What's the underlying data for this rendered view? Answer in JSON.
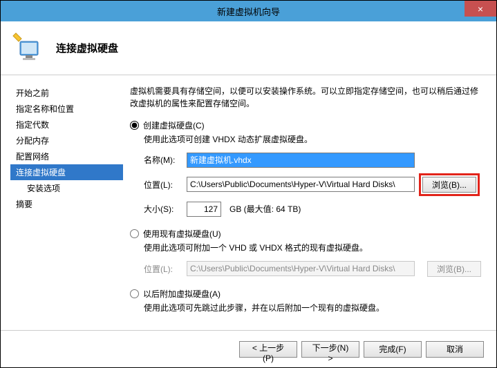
{
  "window": {
    "title": "新建虚拟机向导",
    "close": "×"
  },
  "header": {
    "title": "连接虚拟硬盘"
  },
  "sidebar": {
    "items": [
      {
        "label": "开始之前"
      },
      {
        "label": "指定名称和位置"
      },
      {
        "label": "指定代数"
      },
      {
        "label": "分配内存"
      },
      {
        "label": "配置网络"
      },
      {
        "label": "连接虚拟硬盘",
        "selected": true
      },
      {
        "label": "安装选项",
        "sub": true
      },
      {
        "label": "摘要"
      }
    ]
  },
  "intro": "虚拟机需要具有存储空间，以便可以安装操作系统。可以立即指定存储空间，也可以稍后通过修改虚拟机的属性来配置存储空间。",
  "opt1": {
    "label": "创建虚拟硬盘(C)",
    "desc": "使用此选项可创建 VHDX 动态扩展虚拟硬盘。",
    "name_label": "名称(M):",
    "name_value": "新建虚拟机.vhdx",
    "loc_label": "位置(L):",
    "loc_value": "C:\\Users\\Public\\Documents\\Hyper-V\\Virtual Hard Disks\\",
    "browse": "浏览(B)...",
    "size_label": "大小(S):",
    "size_value": "127",
    "size_suffix": "GB (最大值: 64 TB)"
  },
  "opt2": {
    "label": "使用现有虚拟硬盘(U)",
    "desc": "使用此选项可附加一个 VHD 或 VHDX 格式的现有虚拟硬盘。",
    "loc_label": "位置(L):",
    "loc_value": "C:\\Users\\Public\\Documents\\Hyper-V\\Virtual Hard Disks\\",
    "browse": "浏览(B)..."
  },
  "opt3": {
    "label": "以后附加虚拟硬盘(A)",
    "desc": "使用此选项可先跳过此步骤，并在以后附加一个现有的虚拟硬盘。"
  },
  "footer": {
    "prev": "< 上一步(P)",
    "next": "下一步(N) >",
    "finish": "完成(F)",
    "cancel": "取消"
  }
}
